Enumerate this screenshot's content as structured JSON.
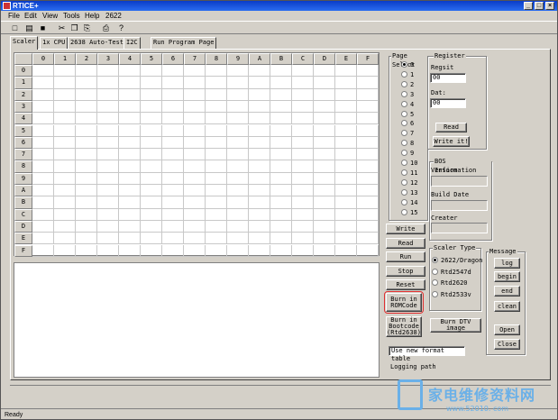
{
  "window": {
    "title": "RTICE+",
    "min": "_",
    "max": "□",
    "close": "×"
  },
  "menu": [
    "File",
    "Edit",
    "View",
    "Tools",
    "Help",
    "2622"
  ],
  "toolbar": {
    "icons": [
      "new-icon",
      "open-icon",
      "save-icon",
      "cut-icon",
      "copy-icon",
      "paste-icon",
      "print-icon",
      "help-icon"
    ],
    "glyphs": [
      "□",
      "▤",
      "■",
      "✂",
      "❐",
      "⎘",
      "⎙",
      "?"
    ]
  },
  "tabs": [
    "Scaler",
    "1x CPU",
    "2638 Auto-Test",
    "I2C",
    "Run Program Page"
  ],
  "grid": {
    "columns": [
      "0",
      "1",
      "2",
      "3",
      "4",
      "5",
      "6",
      "7",
      "8",
      "9",
      "A",
      "B",
      "C",
      "D",
      "E",
      "F"
    ],
    "rows": [
      "0",
      "1",
      "2",
      "3",
      "4",
      "5",
      "6",
      "7",
      "8",
      "9",
      "A",
      "B",
      "C",
      "D",
      "E",
      "F"
    ]
  },
  "page_select": {
    "title": "Page Select",
    "options": [
      "0",
      "1",
      "2",
      "3",
      "4",
      "5",
      "6",
      "7",
      "8",
      "9",
      "10",
      "11",
      "12",
      "13",
      "14",
      "15"
    ],
    "selected": "0"
  },
  "register": {
    "title": "Register",
    "regist_label": "Regsit",
    "regist_value": "00",
    "data_label": "Dat:",
    "data_value": "00",
    "read_label": "Read",
    "write_label": "Write it!"
  },
  "bos": {
    "title": "BOS Information",
    "version_label": "Version",
    "build_label": "Build Date",
    "creater_label": "Creater"
  },
  "actions": {
    "write": "Write",
    "read": "Read",
    "run": "Run",
    "stop": "Stop",
    "reset": "Reset",
    "burn_rom_1": "Burn in",
    "burn_rom_2": "ROMCode",
    "burn_boot_1": "Burn in",
    "burn_boot_2": "Bootcode",
    "burn_boot_3": "(Rtd2638)",
    "burn_dtv_1": "Burn DTV",
    "burn_dtv_2": "image"
  },
  "scaler_type": {
    "title": "Scaler Type",
    "options": [
      "2622/Dragon",
      "Rtd2547d",
      "Rtd2620",
      "Rtd2533v"
    ],
    "selected": "2622/Dragon"
  },
  "message": {
    "title": "Message",
    "log": "log",
    "begin": "begin",
    "end": "end",
    "clean": "clean",
    "open": "Open",
    "close": "Close"
  },
  "format_table": "Use new format table",
  "logging_path": "Logging path",
  "status": "Ready",
  "watermark": {
    "text": "家电维修资料网",
    "url": "www.52010. com"
  }
}
